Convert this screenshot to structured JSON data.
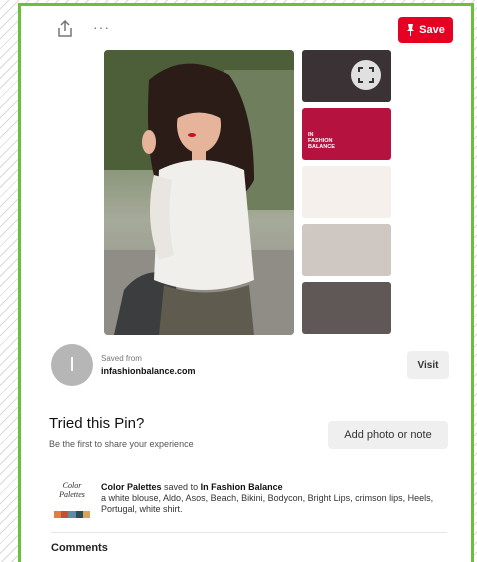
{
  "toolbar": {
    "save_label": "Save",
    "more_label": "···"
  },
  "pin": {
    "palette_brand": "IN FASHION BALANCE",
    "palette_colors": [
      "#3a3234",
      "#b5123f",
      "#f5f0ec",
      "#cfc7c1",
      "#5f5856"
    ]
  },
  "source": {
    "avatar_letter": "I",
    "saved_from_label": "Saved from",
    "domain": "infashionbalance.com",
    "visit_label": "Visit"
  },
  "tried": {
    "title": "Tried this Pin?",
    "subtitle": "Be the first to share your experience",
    "add_label": "Add photo or note"
  },
  "activity": {
    "thumb_text": "Color Palettes",
    "thumb_colors": [
      "#e07f3d",
      "#c44e3a",
      "#5a8ea3",
      "#2f4b57",
      "#d9a553"
    ],
    "board_name": "Color Palettes",
    "saved_to_text": "saved to",
    "target_board": "In Fashion Balance",
    "description": "a white blouse, Aldo, Asos, Beach, Bikini, Bodycon, Bright Lips, crimson lips, Heels, Portugal, white shirt."
  },
  "comments": {
    "title": "Comments"
  },
  "colors": {
    "accent": "#e60023",
    "frame_border": "#6cbf3c"
  }
}
